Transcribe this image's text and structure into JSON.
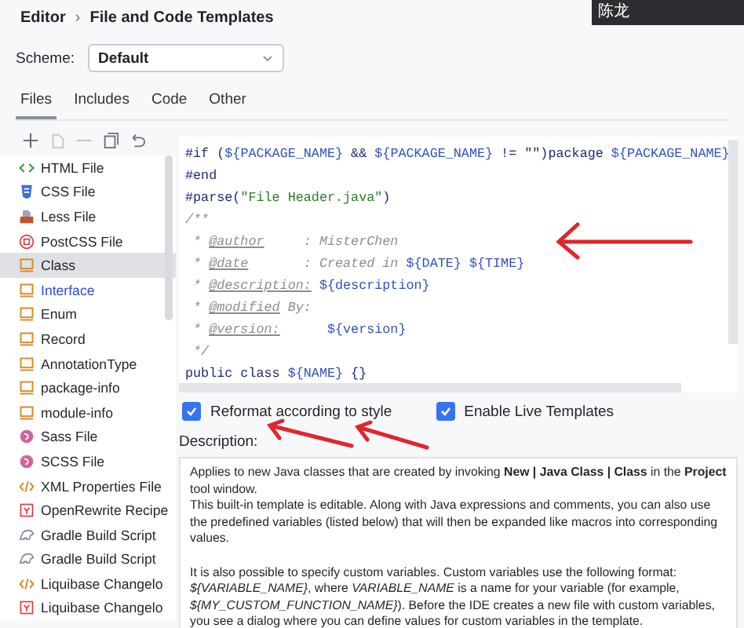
{
  "breadcrumb": {
    "parent": "Editor",
    "separator": "›",
    "current": "File and Code Templates"
  },
  "tooltip": "陈龙",
  "scheme": {
    "label": "Scheme:",
    "value": "Default"
  },
  "tabs": [
    {
      "label": "Files",
      "selected": true
    },
    {
      "label": "Includes",
      "selected": false
    },
    {
      "label": "Code",
      "selected": false
    },
    {
      "label": "Other",
      "selected": false
    }
  ],
  "toolbar": [
    {
      "kind": "add",
      "disabled": false
    },
    {
      "kind": "copy",
      "disabled": true
    },
    {
      "kind": "remove",
      "disabled": true
    },
    {
      "kind": "duplicate",
      "disabled": false
    },
    {
      "kind": "reset",
      "disabled": false
    }
  ],
  "templates": [
    {
      "label": "HTML File",
      "kind": "html",
      "selected": false,
      "modified": false
    },
    {
      "label": "CSS File",
      "kind": "css",
      "selected": false,
      "modified": false
    },
    {
      "label": "Less File",
      "kind": "less",
      "selected": false,
      "modified": false
    },
    {
      "label": "PostCSS File",
      "kind": "postcss",
      "selected": false,
      "modified": false
    },
    {
      "label": "Class",
      "kind": "java",
      "selected": true,
      "modified": false
    },
    {
      "label": "Interface",
      "kind": "java",
      "selected": false,
      "modified": true
    },
    {
      "label": "Enum",
      "kind": "java",
      "selected": false,
      "modified": false
    },
    {
      "label": "Record",
      "kind": "java",
      "selected": false,
      "modified": false
    },
    {
      "label": "AnnotationType",
      "kind": "java",
      "selected": false,
      "modified": false
    },
    {
      "label": "package-info",
      "kind": "java",
      "selected": false,
      "modified": false
    },
    {
      "label": "module-info",
      "kind": "java",
      "selected": false,
      "modified": false
    },
    {
      "label": "Sass File",
      "kind": "sass",
      "selected": false,
      "modified": false
    },
    {
      "label": "SCSS File",
      "kind": "sass",
      "selected": false,
      "modified": false
    },
    {
      "label": "XML Properties File",
      "kind": "xml",
      "selected": false,
      "modified": false
    },
    {
      "label": "OpenRewrite Recipe",
      "kind": "yaml",
      "selected": false,
      "modified": false
    },
    {
      "label": "Gradle Build Script",
      "kind": "gradle",
      "selected": false,
      "modified": false
    },
    {
      "label": "Gradle Build Script",
      "kind": "gradle",
      "selected": false,
      "modified": false
    },
    {
      "label": "Liquibase Changelo",
      "kind": "xml",
      "selected": false,
      "modified": false
    },
    {
      "label": "Liquibase Changelo",
      "kind": "yaml",
      "selected": false,
      "modified": false
    }
  ],
  "code_lines": [
    [
      {
        "kind": "directive",
        "text": "#if ("
      },
      {
        "kind": "var",
        "text": "${PACKAGE_NAME}"
      },
      {
        "kind": "directive",
        "text": " && "
      },
      {
        "kind": "var",
        "text": "${PACKAGE_NAME}"
      },
      {
        "kind": "directive",
        "text": " != \"\")package "
      },
      {
        "kind": "var",
        "text": "${PACKAGE_NAME}"
      }
    ],
    [
      {
        "kind": "directive",
        "text": "#end"
      }
    ],
    [
      {
        "kind": "directive",
        "text": "#parse("
      },
      {
        "kind": "string",
        "text": "\"File Header.java\""
      },
      {
        "kind": "directive",
        "text": ")"
      }
    ],
    [
      {
        "kind": "comment",
        "text": "/**"
      }
    ],
    [
      {
        "kind": "comment",
        "text": " * "
      },
      {
        "kind": "tag",
        "text": "@author"
      },
      {
        "kind": "comment",
        "text": "     : MisterChen"
      }
    ],
    [
      {
        "kind": "comment",
        "text": " * "
      },
      {
        "kind": "tag",
        "text": "@date"
      },
      {
        "kind": "comment",
        "text": "       : Created in "
      },
      {
        "kind": "var",
        "text": "${DATE} ${TIME}"
      }
    ],
    [
      {
        "kind": "comment",
        "text": " * "
      },
      {
        "kind": "tag",
        "text": "@description:"
      },
      {
        "kind": "var",
        "text": " ${description}"
      }
    ],
    [
      {
        "kind": "comment",
        "text": " * "
      },
      {
        "kind": "tag",
        "text": "@modified"
      },
      {
        "kind": "comment",
        "text": " By:"
      }
    ],
    [
      {
        "kind": "comment",
        "text": " * "
      },
      {
        "kind": "tag",
        "text": "@version:"
      },
      {
        "kind": "var",
        "text": "      ${version}"
      }
    ],
    [
      {
        "kind": "comment",
        "text": " */"
      }
    ],
    [
      {
        "kind": "keyword",
        "text": "public class "
      },
      {
        "kind": "var",
        "text": "${NAME}"
      },
      {
        "kind": "keyword",
        "text": " {}"
      }
    ]
  ],
  "options": [
    {
      "label": "Reformat according to style",
      "checked": true
    },
    {
      "label": "Enable Live Templates",
      "checked": true
    }
  ],
  "description": {
    "label": "Description:",
    "paragraphs": [
      "Applies to new Java classes that are created by invoking **New | Java Class | Class** in the **Project** tool window.",
      "This built-in template is editable. Along with Java expressions and comments, you can also use the predefined variables (listed below) that will then be expanded like macros into corresponding values.",
      "It is also possible to specify custom variables. Custom variables use the following format: *${VARIABLE_NAME}*, where *VARIABLE_NAME* is a name for your variable (for example, *${MY_CUSTOM_FUNCTION_NAME}*). Before the IDE creates a new file with custom variables, you see a dialog where you can define values for custom variables in the template."
    ]
  }
}
